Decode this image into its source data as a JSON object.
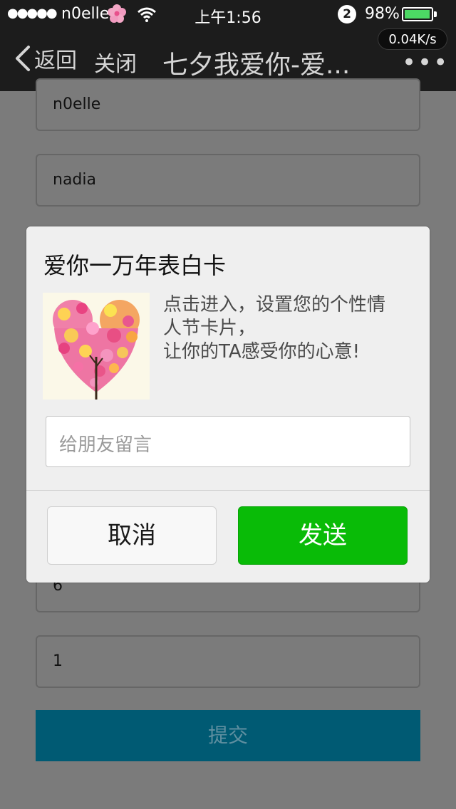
{
  "status_bar": {
    "signal": "●●●●●",
    "carrier": "n0elle",
    "time": "上午1:56",
    "notification_count": "2",
    "battery_percent": "98%",
    "battery_level": 0.98,
    "battery_color": "#4cd964"
  },
  "nav": {
    "back_label": "返回",
    "close_label": "关闭",
    "title": "七夕我爱你-爱...",
    "more": "•••",
    "network_speed": "0.04K/s"
  },
  "form": {
    "fields": [
      "n0elle",
      "nadia",
      "6",
      "1"
    ],
    "submit_label": "提交",
    "submit_color": "#005a73"
  },
  "dialog": {
    "title": "爱你一万年表白卡",
    "description_lines": [
      "点击进入，设置您的个性情",
      "人节卡片，",
      "让你的TA感受你的心意!"
    ],
    "message_placeholder": "给朋友留言",
    "cancel_label": "取消",
    "send_label": "发送",
    "send_color": "#09bb07"
  },
  "icons": {
    "back": "chevron-left-icon",
    "wifi": "wifi-icon",
    "flower": "flower-icon",
    "more": "more-icon"
  }
}
